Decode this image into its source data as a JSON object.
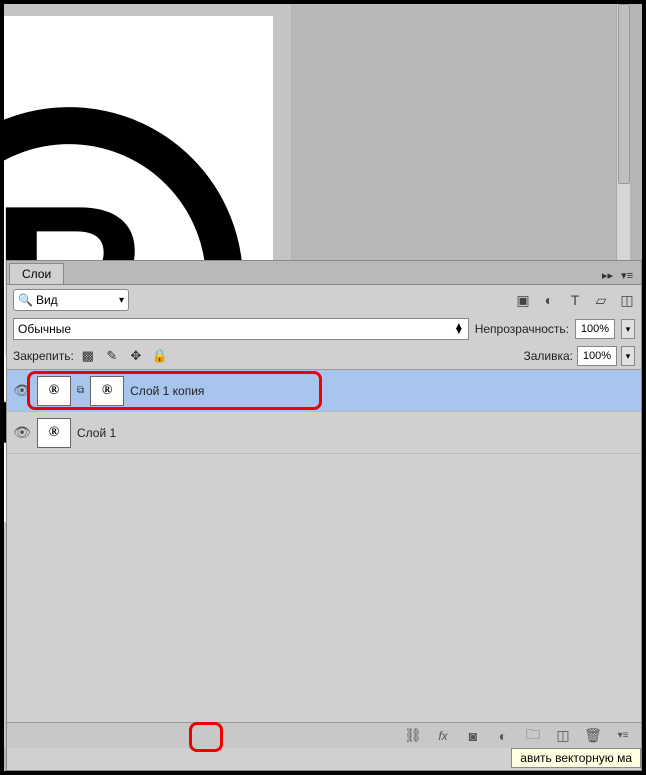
{
  "panel": {
    "title": "Слои"
  },
  "filter": {
    "label": "Вид"
  },
  "blend": {
    "mode": "Обычные",
    "opacity_label": "Непрозрачность:",
    "opacity_value": "100%"
  },
  "lock": {
    "label": "Закрепить:",
    "fill_label": "Заливка:",
    "fill_value": "100%"
  },
  "layers": [
    {
      "name": "Слой 1 копия",
      "selected": true,
      "has_mask": true
    },
    {
      "name": "Слой 1",
      "selected": false,
      "has_mask": false
    }
  ],
  "tooltip": "авить векторную ма",
  "reg_glyph": "®"
}
